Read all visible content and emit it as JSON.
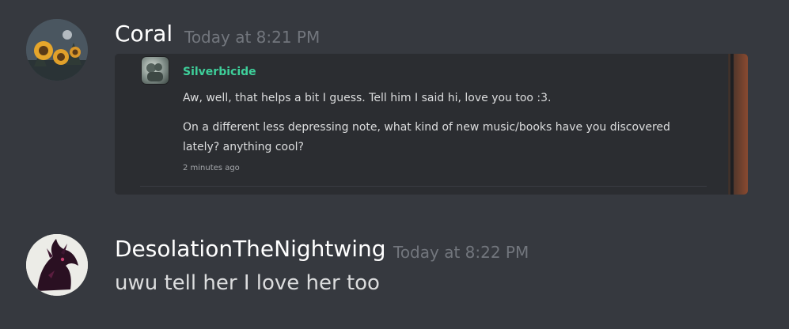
{
  "messages": [
    {
      "username": "Coral",
      "timestamp": "Today at 8:21 PM",
      "avatar_icon": "sunflower-avatar",
      "embed": {
        "author": "Silverbicide",
        "author_color": "#3ecf9a",
        "lines": [
          "Aw, well, that helps a bit I guess. Tell him I said hi, love you too :3.",
          "On a different less depressing note, what kind of new music/books have you discovered",
          "lately? anything cool?"
        ],
        "time": "2 minutes ago"
      }
    },
    {
      "username": "DesolationTheNightwing",
      "timestamp": "Today at 8:22 PM",
      "avatar_icon": "dragon-avatar",
      "content": "uwu tell her I love her too"
    }
  ],
  "colors": {
    "background": "#36393f",
    "username": "#ffffff",
    "timestamp": "#72767d",
    "text": "#dcddde"
  }
}
